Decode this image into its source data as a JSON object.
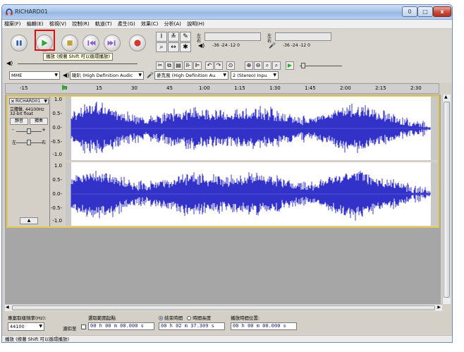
{
  "window": {
    "title": "RICHARD01",
    "controls": [
      "0",
      "□",
      "x"
    ]
  },
  "menu": [
    "檔案(F)",
    "編輯(E)",
    "檢視(V)",
    "控制(R)",
    "軌道(T)",
    "產生(G)",
    "效果(C)",
    "分析(A)",
    "說明(H)"
  ],
  "transport": {
    "tooltip": "播放 (按著 Shift 可以循環播放)"
  },
  "meters": {
    "play_lr_top": "左",
    "play_lr_bottom": "右",
    "play_scale": "-36  -24  -12  0",
    "rec_lr_top": "左",
    "rec_lr_bottom": "右",
    "rec_scale": "-36  -24  -12  0"
  },
  "devices": {
    "host": "MME",
    "output": "喇叭 (High Definition Audic",
    "input": "麥克風 (High Definition Au",
    "channels": "2 (Stereo) Inpu"
  },
  "ruler": {
    "labels": [
      "-15",
      "0",
      "15",
      "30",
      "45",
      "1:00",
      "1:15",
      "1:30",
      "1:45",
      "2:00",
      "2:15",
      "2:30"
    ]
  },
  "track": {
    "name": "RICHARD01",
    "info1": "立體聲, 44100Hz",
    "info2": "32-bit float",
    "mute": "靜音",
    "solo": "獨奏",
    "gain_minus": "-",
    "gain_plus": "+",
    "pan_left": "左",
    "pan_right": "右",
    "scale": [
      "1.0",
      "0.5-",
      "0.0-",
      "-0.5-",
      "-1.0"
    ]
  },
  "selection_bar": {
    "rate_label": "專案取樣頻率(Hz):",
    "rate_value": "44100",
    "snap_label": "濾扣至",
    "start_label": "選取範圍起點",
    "end_label": "結束時間",
    "length_label": "時間長度",
    "audio_pos_label": "播放時間位置:",
    "start_value": "00 h 00 m 00.000 s",
    "end_value": "00 h 02 m 37.309 s",
    "audio_pos_value": "00 h 00 m 00.000 s"
  },
  "status": "播放 (按著 Shift 可以循環播放)",
  "colors": {
    "waveform": "#3232c8",
    "highlight": "#e01010",
    "track_border": "#e4c94a"
  }
}
